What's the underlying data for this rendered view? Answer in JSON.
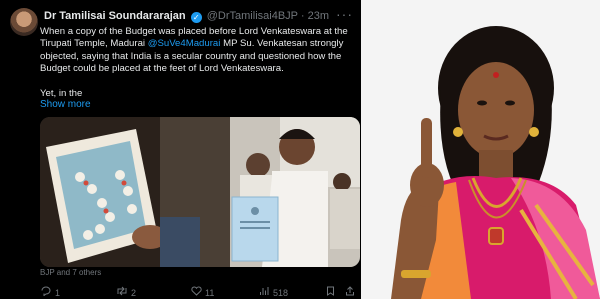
{
  "tweet": {
    "author": "Dr Tamilisai Soundararajan",
    "handle": "@DrTamilisai4BJP",
    "separator": "·",
    "time": "23m",
    "more_label": "···",
    "lines": [
      [
        "When a copy of the Budget was placed before Lord Venkateswara at the"
      ],
      [
        "Tirupati Temple, Madurai ",
        "@SuVe4Madurai",
        " MP Su. Venkatesan strongly"
      ],
      [
        "objected, saying that India is a secular country and questioned how the"
      ],
      [
        "Budget could be placed at the feet of Lord Venkateswara."
      ]
    ],
    "line_4": "Yet, in the",
    "show_more": "Show more",
    "tagged": "BJP and 7 others",
    "actions": {
      "replies": "1",
      "reposts": "2",
      "likes": "11",
      "views": "518"
    }
  },
  "icons": {
    "reply": "reply-icon",
    "repost": "repost-icon",
    "like": "like-icon",
    "views": "views-icon",
    "bookmark": "bookmark-icon",
    "share": "share-icon",
    "verified": "verified-badge-icon",
    "more": "more-options-icon"
  },
  "colors": {
    "tweet_bg": "#000000",
    "text": "#e7e9ea",
    "muted": "#71767b",
    "link": "#1d9bf0",
    "saree_pink": "#d81b6b"
  }
}
